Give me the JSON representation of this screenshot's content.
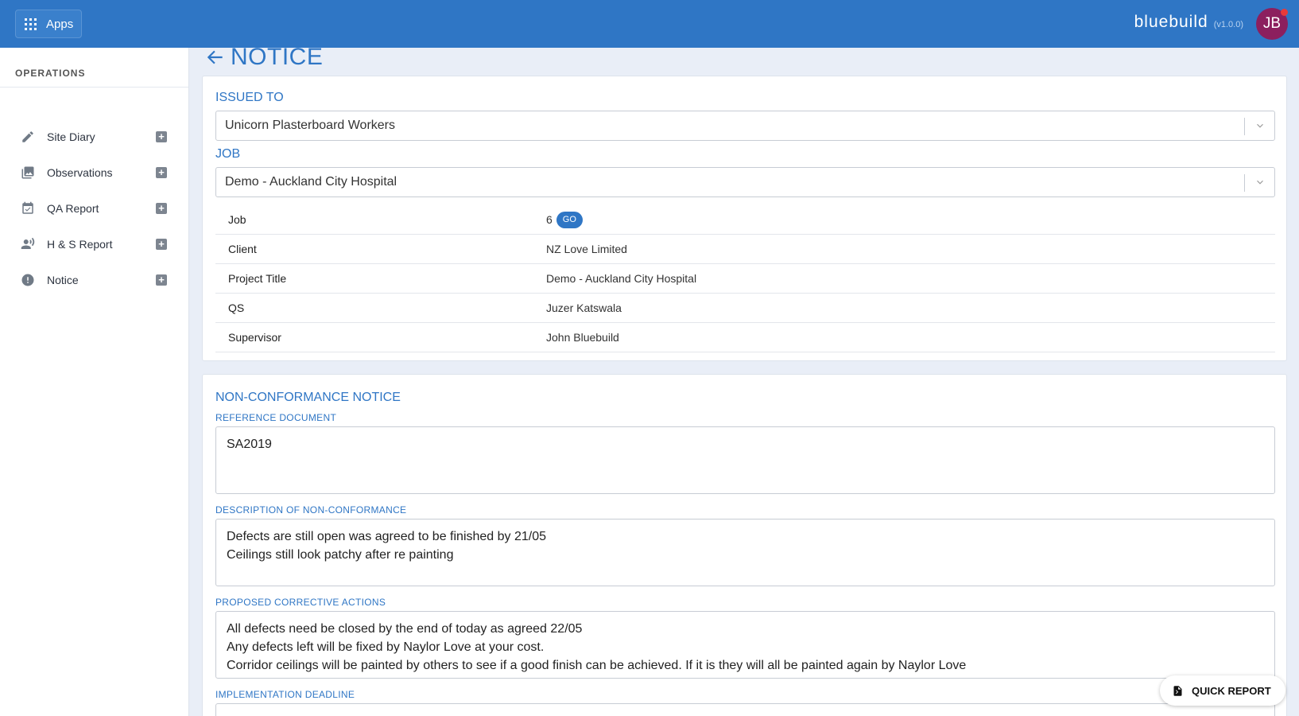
{
  "topbar": {
    "apps_label": "Apps",
    "brand_name": "bluebuild",
    "version": "(v1.0.0)",
    "avatar_initials": "JB"
  },
  "sidebar": {
    "heading": "OPERATIONS",
    "items": [
      {
        "label": "Site Diary",
        "icon": "pencil-icon"
      },
      {
        "label": "Observations",
        "icon": "photos-icon"
      },
      {
        "label": "QA Report",
        "icon": "calendar-check-icon"
      },
      {
        "label": "H & S Report",
        "icon": "people-icon"
      },
      {
        "label": "Notice",
        "icon": "alert-circle-icon"
      }
    ]
  },
  "page": {
    "title": "NOTICE"
  },
  "issued_to": {
    "label": "ISSUED TO",
    "value": "Unicorn Plasterboard Workers"
  },
  "job": {
    "label": "JOB",
    "value": "Demo - Auckland City Hospital",
    "details": [
      {
        "key": "Job",
        "value": "6",
        "badge": "GO"
      },
      {
        "key": "Client",
        "value": "NZ Love Limited"
      },
      {
        "key": "Project Title",
        "value": "Demo - Auckland City Hospital"
      },
      {
        "key": "QS",
        "value": "Juzer Katswala"
      },
      {
        "key": "Supervisor",
        "value": "John Bluebuild"
      }
    ]
  },
  "ncn": {
    "title": "NON-CONFORMANCE NOTICE",
    "reference_label": "REFERENCE DOCUMENT",
    "reference_value": "SA2019",
    "description_label": "DESCRIPTION OF NON-CONFORMANCE",
    "description_value": "Defects are still open was agreed to be finished by 21/05\nCeilings still look patchy after re painting",
    "actions_label": "PROPOSED CORRECTIVE ACTIONS",
    "actions_value": "All defects need be closed by the end of today as agreed 22/05\nAny defects left will be fixed by Naylor Love at your cost.\nCorridor ceilings will be painted by others to see if a good finish can be achieved. If it is they will all be painted again by Naylor Love",
    "deadline_label": "IMPLEMENTATION DEADLINE"
  },
  "quick_report": {
    "label": "QUICK REPORT"
  },
  "colors": {
    "brand_blue": "#2f76c5",
    "avatar": "#8c1f5e",
    "notification": "#e83a3a"
  }
}
